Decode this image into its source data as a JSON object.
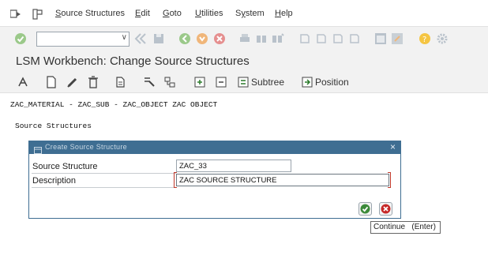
{
  "menu": {
    "items": [
      {
        "pre": "",
        "ul": "S",
        "post": "ource Structures"
      },
      {
        "pre": "",
        "ul": "E",
        "post": "dit"
      },
      {
        "pre": "",
        "ul": "G",
        "post": "oto"
      },
      {
        "pre": "",
        "ul": "U",
        "post": "tilities"
      },
      {
        "pre": "S",
        "ul": "y",
        "post": "stem"
      },
      {
        "pre": "",
        "ul": "H",
        "post": "elp"
      }
    ]
  },
  "command_field": {
    "value": ""
  },
  "title": "LSM Workbench: Change Source Structures",
  "app_toolbar": {
    "subtree_label": "Subtree",
    "position_label": "Position"
  },
  "content": {
    "path": "ZAC_MATERIAL - ZAC_SUB - ZAC_OBJECT ZAC OBJECT",
    "section_label": "Source Structures"
  },
  "dialog": {
    "title": "Create Source Structure",
    "fields": [
      {
        "label": "Source Structure",
        "value": "ZAC_33"
      },
      {
        "label": "Description",
        "value": "ZAC SOURCE STRUCTURE"
      }
    ]
  },
  "tooltip": "Continue   (Enter)",
  "colors": {
    "dialog_header": "#3f6e92",
    "confirm_green": "#3c8a3a",
    "cancel_red": "#c62828"
  }
}
